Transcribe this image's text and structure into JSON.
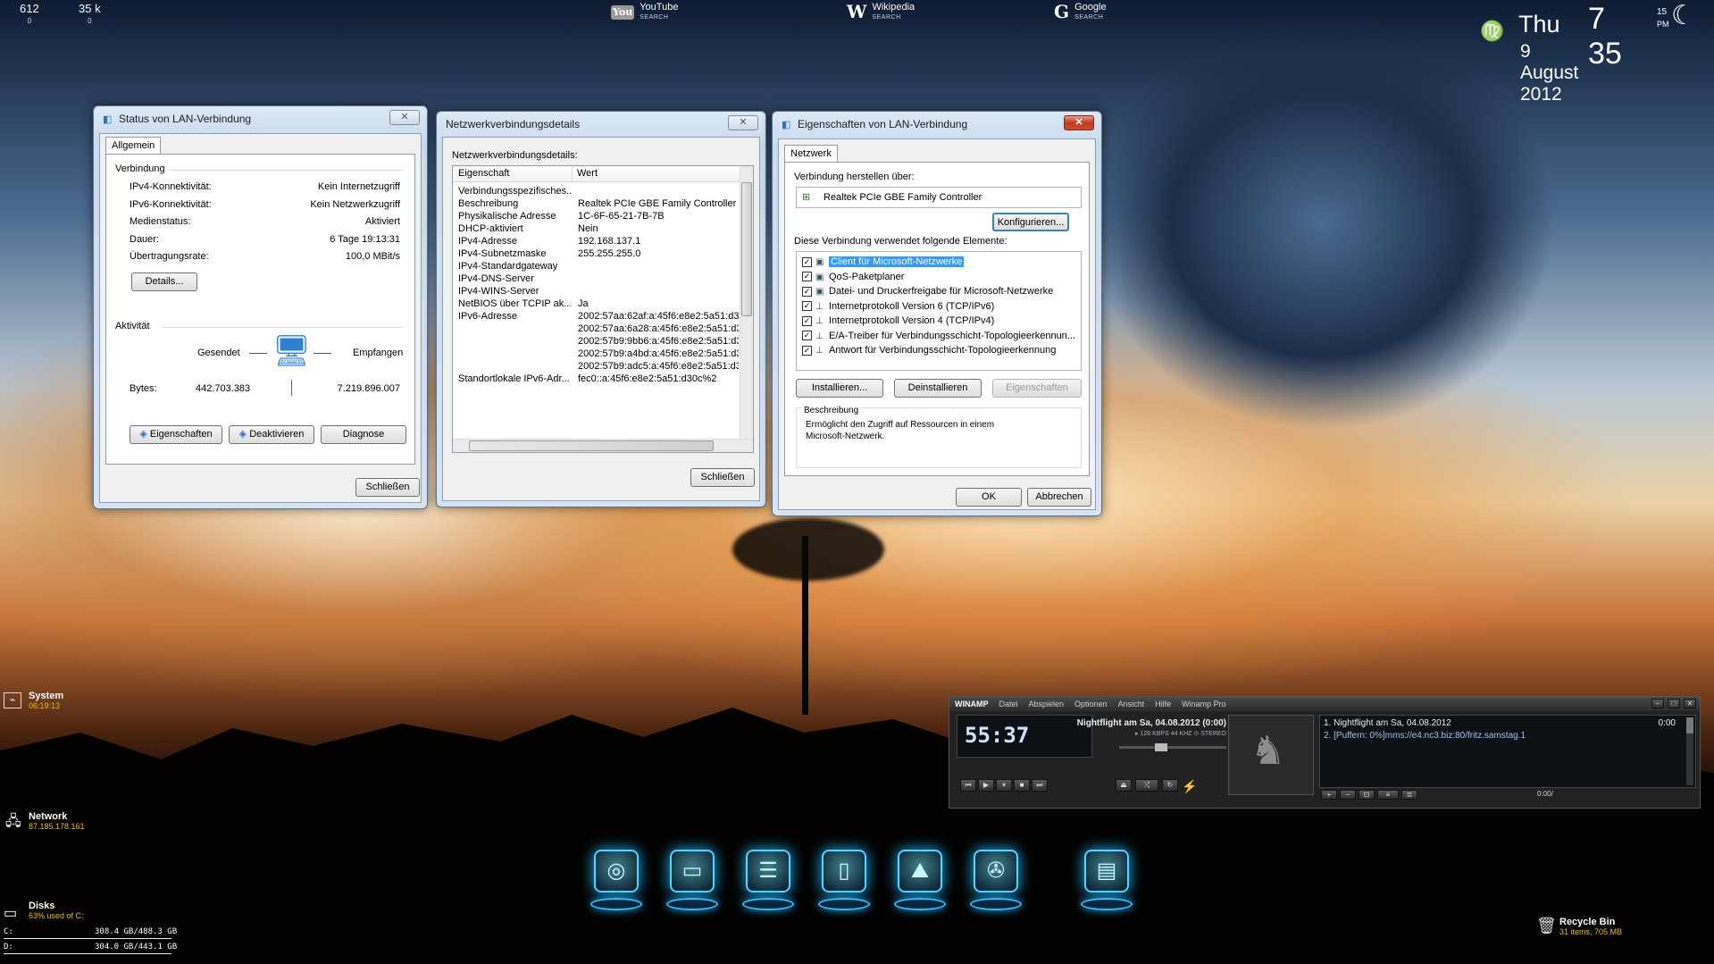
{
  "desktop": {
    "stats": [
      {
        "value": "612",
        "sub": "0"
      },
      {
        "value": "35 k",
        "sub": "0"
      }
    ],
    "search": [
      {
        "icon": "youtube-icon",
        "glyph": "You",
        "name": "YouTube",
        "sub": "SEARCH"
      },
      {
        "icon": "wikipedia-icon",
        "glyph": "W",
        "name": "Wikipedia",
        "sub": "SEARCH"
      },
      {
        "icon": "google-icon",
        "glyph": "G",
        "name": "Google",
        "sub": "SEARCH"
      }
    ],
    "clock": {
      "day": "Thu",
      "time": "7 35",
      "seconds": "15",
      "ampm": "PM",
      "date": "9 August 2012",
      "zodiac": "♍"
    },
    "left_widgets": {
      "system": {
        "label": "System",
        "sub": "06:19:13"
      },
      "network": {
        "label": "Network",
        "sub": "87.185.178.161"
      },
      "disks": {
        "label": "Disks",
        "sub": "63% used of C:",
        "rows": [
          {
            "drive": "C:",
            "value": "308.4 GB/488.3 GB"
          },
          {
            "drive": "D:",
            "value": "304.0 GB/443.1 GB"
          }
        ]
      }
    },
    "recycle": {
      "label": "Recycle Bin",
      "sub": "31  items, 705 MB"
    }
  },
  "status_window": {
    "title": "Status von LAN-Verbindung",
    "tab": "Allgemein",
    "group_connection": "Verbindung",
    "rows": [
      {
        "label": "IPv4-Konnektivität:",
        "value": "Kein Internetzugriff"
      },
      {
        "label": "IPv6-Konnektivität:",
        "value": "Kein Netzwerkzugriff"
      },
      {
        "label": "Medienstatus:",
        "value": "Aktiviert"
      },
      {
        "label": "Dauer:",
        "value": "6 Tage 19:13:31"
      },
      {
        "label": "Übertragungsrate:",
        "value": "100,0 MBit/s"
      }
    ],
    "details_btn": "Details...",
    "group_activity": "Aktivität",
    "sent_label": "Gesendet",
    "recv_label": "Empfangen",
    "bytes_label": "Bytes:",
    "bytes_sent": "442.703.383",
    "bytes_recv": "7.219.896.007",
    "btn_properties": "Eigenschaften",
    "btn_deactivate": "Deaktivieren",
    "btn_diagnose": "Diagnose",
    "btn_close": "Schließen"
  },
  "details_window": {
    "title": "Netzwerkverbindungsdetails",
    "caption": "Netzwerkverbindungsdetails:",
    "col_property": "Eigenschaft",
    "col_value": "Wert",
    "rows": [
      {
        "p": "Verbindungsspezifisches...",
        "v": ""
      },
      {
        "p": "Beschreibung",
        "v": "Realtek PCIe GBE Family Controller"
      },
      {
        "p": "Physikalische Adresse",
        "v": "1C-6F-65-21-7B-7B"
      },
      {
        "p": "DHCP-aktiviert",
        "v": "Nein"
      },
      {
        "p": "IPv4-Adresse",
        "v": "192.168.137.1"
      },
      {
        "p": "IPv4-Subnetzmaske",
        "v": "255.255.255.0"
      },
      {
        "p": "IPv4-Standardgateway",
        "v": ""
      },
      {
        "p": "IPv4-DNS-Server",
        "v": ""
      },
      {
        "p": "IPv4-WINS-Server",
        "v": ""
      },
      {
        "p": "NetBIOS über TCPIP ak...",
        "v": "Ja"
      },
      {
        "p": "IPv6-Adresse",
        "v": "2002:57aa:62af:a:45f6:e8e2:5a51:d3"
      },
      {
        "p": "",
        "v": "2002:57aa:6a28:a:45f6:e8e2:5a51:d3"
      },
      {
        "p": "",
        "v": "2002:57b9:9bb6:a:45f6:e8e2:5a51:d3"
      },
      {
        "p": "",
        "v": "2002:57b9:a4bd:a:45f6:e8e2:5a51:d3"
      },
      {
        "p": "",
        "v": "2002:57b9:adc5:a:45f6:e8e2:5a51:d3"
      },
      {
        "p": "Standortlokale IPv6-Adr...",
        "v": "fec0::a:45f6:e8e2:5a51:d30c%2"
      }
    ],
    "btn_close": "Schließen"
  },
  "props_window": {
    "title": "Eigenschaften von LAN-Verbindung",
    "tab": "Netzwerk",
    "connect_label": "Verbindung herstellen über:",
    "adapter": "Realtek PCIe GBE Family Controller",
    "btn_configure": "Konfigurieren...",
    "items_label": "Diese Verbindung verwendet folgende Elemente:",
    "items": [
      {
        "label": "Client für Microsoft-Netzwerke",
        "checked": "✓",
        "selected": true
      },
      {
        "label": "QoS-Paketplaner",
        "checked": "✓"
      },
      {
        "label": "Datei- und Druckerfreigabe für Microsoft-Netzwerke",
        "checked": "✓"
      },
      {
        "label": "Internetprotokoll Version 6 (TCP/IPv6)",
        "checked": "✓"
      },
      {
        "label": "Internetprotokoll Version 4 (TCP/IPv4)",
        "checked": "✓"
      },
      {
        "label": "E/A-Treiber für Verbindungsschicht-Topologieerkennun...",
        "checked": "✓"
      },
      {
        "label": "Antwort für Verbindungsschicht-Topologieerkennung",
        "checked": "✓"
      }
    ],
    "btn_install": "Installieren...",
    "btn_uninstall": "Deinstallieren",
    "btn_props": "Eigenschaften",
    "desc_label": "Beschreibung",
    "desc_text": "Ermöglicht den Zugriff auf Ressourcen in einem Microsoft-Netzwerk.",
    "btn_ok": "OK",
    "btn_cancel": "Abbrechen"
  },
  "winamp": {
    "logo": "WINAMP",
    "menu": [
      "Datei",
      "Abspielen",
      "Optionen",
      "Ansicht",
      "Hilfe",
      "Winamp Pro"
    ],
    "time": "55:37",
    "track": "Nightflight am Sa, 04.08.2012 (0:00)",
    "kbps": "▸ 128 KBPS  44 KHZ  ⊙ STEREO",
    "playlist": [
      "1. Nightflight am Sa, 04.08.2012",
      "2. [Puffern: 0%]mms://e4.nc3.biz:80/fritz.samstag.1"
    ],
    "pl_time": "0:00",
    "pl_total": "0:00/"
  },
  "colors": {
    "accent": "#3399ff",
    "dock_glow": "#56d3ff"
  }
}
